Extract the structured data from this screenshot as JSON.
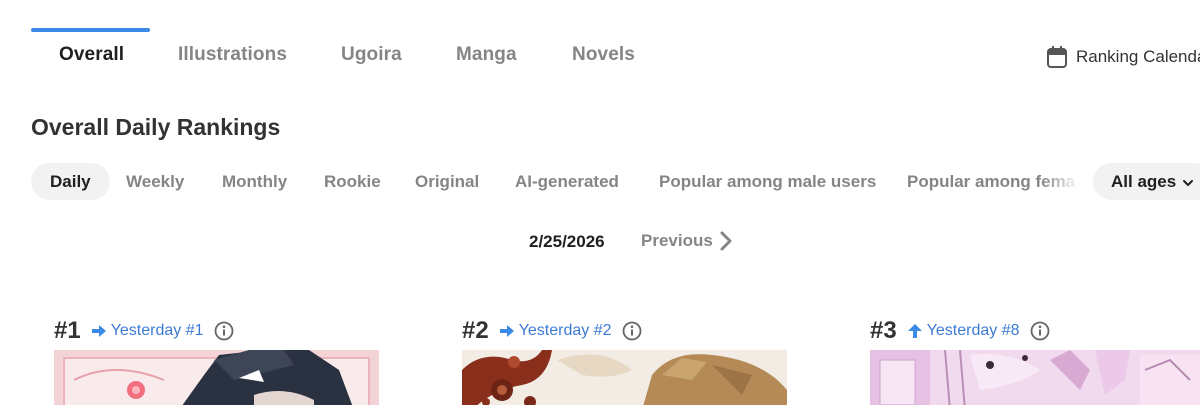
{
  "tabs": {
    "items": [
      "Overall",
      "Illustrations",
      "Ugoira",
      "Manga",
      "Novels"
    ],
    "active": "Overall"
  },
  "calendar": {
    "label": "Ranking Calenda",
    "icon": "calendar-icon"
  },
  "heading": "Overall Daily Rankings",
  "filters": {
    "items": [
      "Daily",
      "Weekly",
      "Monthly",
      "Rookie",
      "Original",
      "AI-generated",
      "Popular among male users",
      "Popular among fema"
    ],
    "active": "Daily"
  },
  "age_select": {
    "label": "All ages",
    "icon": "chevron-down-icon"
  },
  "date_nav": {
    "date": "2/25/2026",
    "previous": "Previous",
    "icon": "chevron-right-icon"
  },
  "rankings": [
    {
      "rank": "#1",
      "yesterday": "Yesterday #1",
      "trend": "same",
      "icon": "arrow-right-icon"
    },
    {
      "rank": "#2",
      "yesterday": "Yesterday #2",
      "trend": "same",
      "icon": "arrow-right-icon"
    },
    {
      "rank": "#3",
      "yesterday": "Yesterday #8",
      "trend": "up",
      "icon": "arrow-up-icon"
    }
  ],
  "colors": {
    "accent": "#3d8ae6",
    "link": "#3d7ad6",
    "muted": "#858585",
    "pill_bg": "#f2f2f2"
  }
}
